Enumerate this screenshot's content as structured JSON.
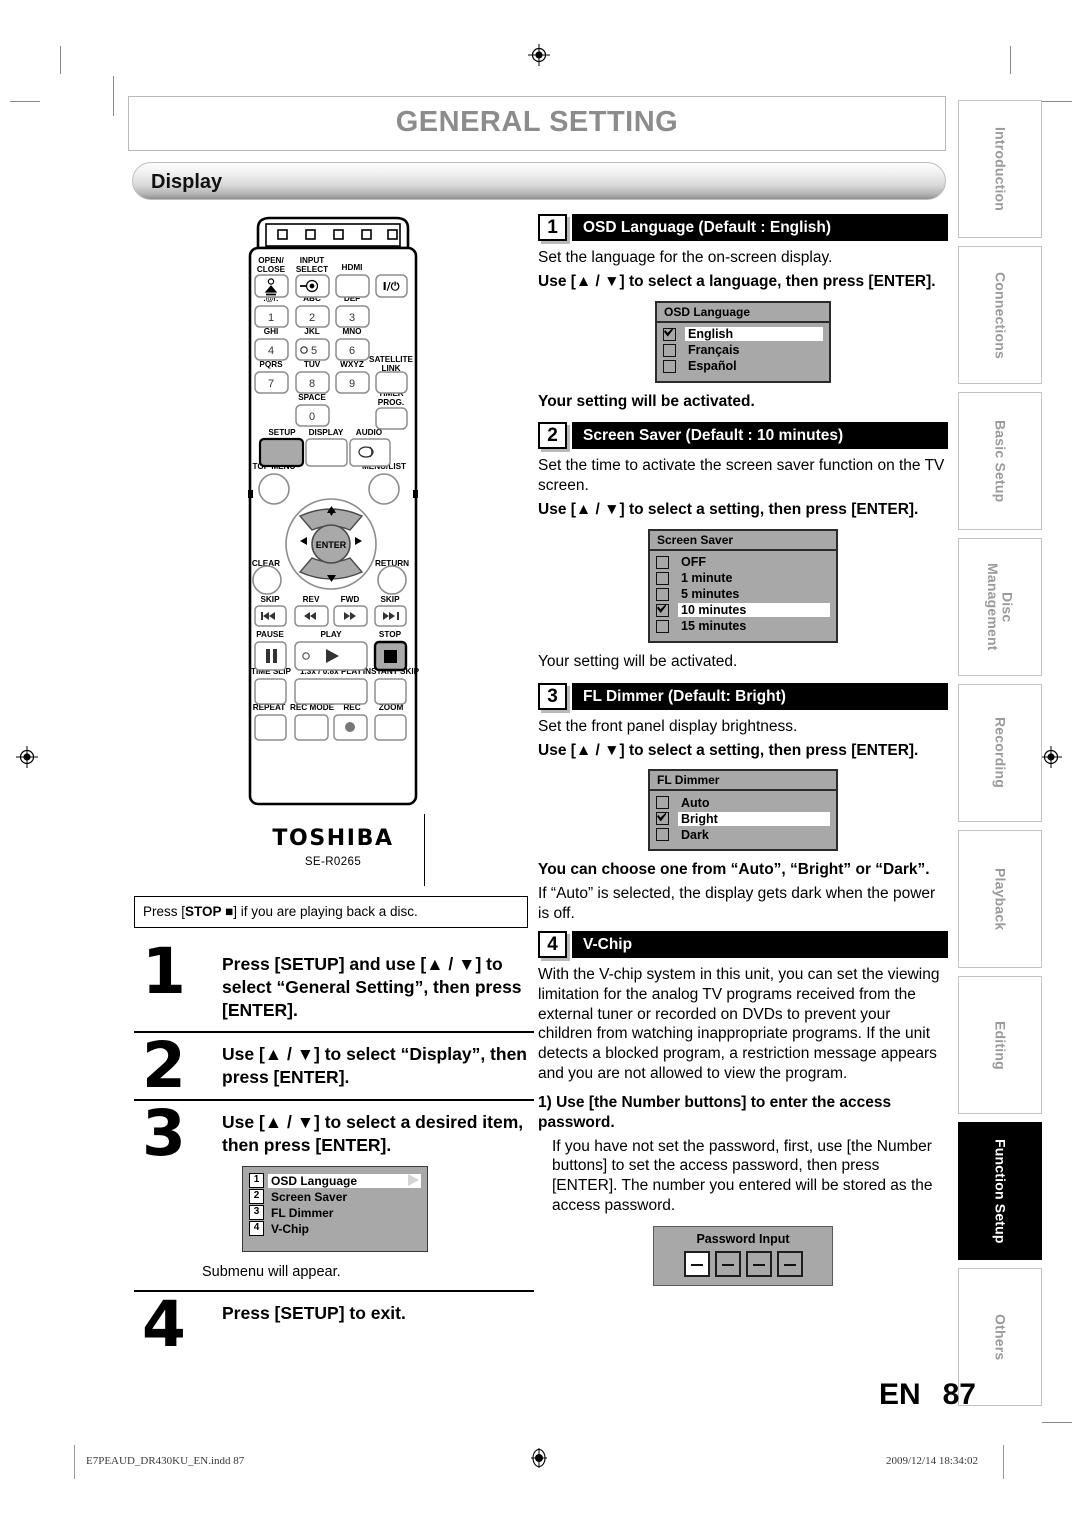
{
  "header": {
    "title": "GENERAL SETTING",
    "section": "Display"
  },
  "left": {
    "remote": {
      "brand": "TOSHIBA",
      "model": "SE-R0265",
      "buttons": {
        "open_close": "OPEN/\nCLOSE",
        "input_select": "INPUT\nSELECT",
        "hdmi": "HDMI",
        "power": "I/⏻",
        "k1_sub": ".@/:",
        "k2_sub": "ABC",
        "k3_sub": "DEF",
        "k4_sub": "GHI",
        "k5_sub": "JKL",
        "k6_sub": "MNO",
        "k7_sub": "PQRS",
        "k8_sub": "TUV",
        "k9_sub": "WXYZ",
        "k0_sub": "SPACE",
        "satellite_link": "SATELLITE\nLINK",
        "timer_prog": "TIMER\nPROG.",
        "setup": "SETUP",
        "display": "DISPLAY",
        "audio": "AUDIO",
        "top_menu": "TOP MENU",
        "menu_list": "MENU/LIST",
        "enter": "ENTER",
        "clear": "CLEAR",
        "return": "RETURN",
        "skip_back": "SKIP",
        "rev": "REV",
        "fwd": "FWD",
        "skip_fwd": "SKIP",
        "pause": "PAUSE",
        "play": "PLAY",
        "stop": "STOP",
        "time_slip": "TIME SLIP",
        "speed_play": "1.3x / 0.8x PLAY",
        "instant_skip": "INSTANT SKIP",
        "repeat": "REPEAT",
        "rec_mode": "REC MODE",
        "rec": "REC",
        "zoom": "ZOOM",
        "digits": [
          "1",
          "2",
          "3",
          "4",
          "5",
          "6",
          "7",
          "8",
          "9",
          "0"
        ]
      }
    },
    "note": {
      "pre": "Press [",
      "key": "STOP ■",
      "post": "] if you are playing back a disc."
    },
    "steps": [
      {
        "num": "1",
        "text": "Press [SETUP] and use [▲ / ▼] to select “General Setting”, then press [ENTER]."
      },
      {
        "num": "2",
        "text": "Use [▲ / ▼] to select “Display”, then press [ENTER]."
      },
      {
        "num": "3",
        "text": "Use [▲ / ▼] to select a desired item, then press [ENTER]."
      },
      {
        "num": "4",
        "text": "Press [SETUP] to exit."
      }
    ],
    "submenu": {
      "items": [
        {
          "num": "1",
          "label": "OSD Language",
          "selected": true
        },
        {
          "num": "2",
          "label": "Screen Saver",
          "selected": false
        },
        {
          "num": "3",
          "label": "FL Dimmer",
          "selected": false
        },
        {
          "num": "4",
          "label": "V-Chip",
          "selected": false
        }
      ],
      "caption": "Submenu will appear."
    }
  },
  "right": {
    "sections": [
      {
        "num": "1",
        "heading": "OSD Language (Default : English)",
        "desc": "Set the language for the on-screen display.",
        "instruction": "Use [▲ / ▼] to select a language, then press [ENTER].",
        "osd": {
          "title": "OSD Language",
          "options": [
            {
              "label": "English",
              "checked": true
            },
            {
              "label": "Français",
              "checked": false
            },
            {
              "label": "Español",
              "checked": false
            }
          ]
        },
        "after": "Your setting will be activated."
      },
      {
        "num": "2",
        "heading": "Screen Saver (Default : 10 minutes)",
        "desc": "Set the time to activate the screen saver function on the TV screen.",
        "instruction": "Use [▲ / ▼] to select a setting, then press [ENTER].",
        "osd": {
          "title": "Screen Saver",
          "options": [
            {
              "label": "OFF",
              "checked": false
            },
            {
              "label": "1 minute",
              "checked": false
            },
            {
              "label": "5 minutes",
              "checked": false
            },
            {
              "label": "10  minutes",
              "checked": true
            },
            {
              "label": "15  minutes",
              "checked": false
            }
          ]
        },
        "after": "Your setting will be activated."
      },
      {
        "num": "3",
        "heading": "FL Dimmer (Default: Bright)",
        "desc": "Set the front panel display brightness.",
        "instruction": "Use [▲ / ▼] to select a setting, then press [ENTER].",
        "osd": {
          "title": "FL Dimmer",
          "options": [
            {
              "label": "Auto",
              "checked": false
            },
            {
              "label": "Bright",
              "checked": true
            },
            {
              "label": "Dark",
              "checked": false
            }
          ]
        },
        "after_bold": "You can choose one from “Auto”, “Bright” or “Dark”.",
        "after": "If “Auto” is selected, the display gets dark when the power is off."
      },
      {
        "num": "4",
        "heading": "V-Chip",
        "desc": "With the V-chip system in this unit, you can set the viewing limitation for the analog TV programs received from the external tuner or recorded on DVDs to prevent your children from watching inappropriate programs. If the unit detects a blocked program, a restriction message appears and you are not allowed to view the program.",
        "step1_bold": "1) Use [the Number buttons] to enter the access password.",
        "step1_body": "If you have not set the password, first, use [the Number buttons] to set the access password, then press [ENTER]. The number you entered will be stored as the access password.",
        "password": {
          "title": "Password Input",
          "boxes": [
            "—",
            "—",
            "—",
            "—"
          ]
        }
      }
    ]
  },
  "rail": {
    "tabs": [
      {
        "label": "Introduction",
        "active": false
      },
      {
        "label": "Connections",
        "active": false
      },
      {
        "label": "Basic Setup",
        "active": false
      },
      {
        "label": "Disc\nManagement",
        "active": false
      },
      {
        "label": "Recording",
        "active": false
      },
      {
        "label": "Playback",
        "active": false
      },
      {
        "label": "Editing",
        "active": false
      },
      {
        "label": "Function Setup",
        "active": true
      },
      {
        "label": "Others",
        "active": false
      }
    ]
  },
  "footer": {
    "lang": "EN",
    "page": "87",
    "file": "E7PEAUD_DR430KU_EN.indd   87",
    "timestamp": "2009/12/14   18:34:02"
  }
}
